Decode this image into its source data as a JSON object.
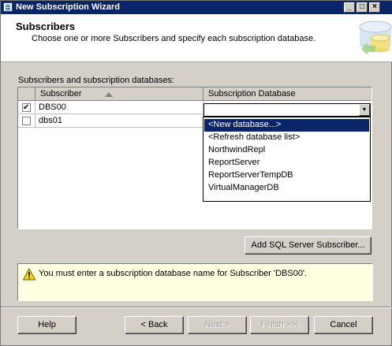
{
  "window": {
    "title": "New Subscription Wizard"
  },
  "titlebar_buttons": {
    "minimize": "_",
    "maximize": "□",
    "close": "×"
  },
  "header": {
    "title": "Subscribers",
    "description": "Choose one or more Subscribers and specify each subscription database."
  },
  "grid": {
    "label": "Subscribers and subscription databases:",
    "columns": [
      "Subscriber",
      "Subscription Database"
    ],
    "rows": [
      {
        "checked": true,
        "subscriber": "DBS00",
        "database": ""
      },
      {
        "checked": false,
        "subscriber": "dbs01",
        "database": ""
      }
    ]
  },
  "dropdown": {
    "options": [
      "<New database...>",
      "<Refresh database list>",
      "NorthwindRepl",
      "ReportServer",
      "ReportServerTempDB",
      "VirtualManagerDB"
    ],
    "highlighted_index": 0
  },
  "buttons": {
    "add_subscriber": "Add SQL Server Subscriber...",
    "help": "Help",
    "back": "< Back",
    "next": "Next >",
    "finish": "Finish >>|",
    "cancel": "Cancel"
  },
  "message": {
    "text": "You must enter a subscription database name for Subscriber 'DBS00'."
  },
  "colors": {
    "titlebar": "#0a246a",
    "selection": "#0a246a",
    "message_bg": "#ffffe1",
    "warning": "#f5d90a"
  }
}
